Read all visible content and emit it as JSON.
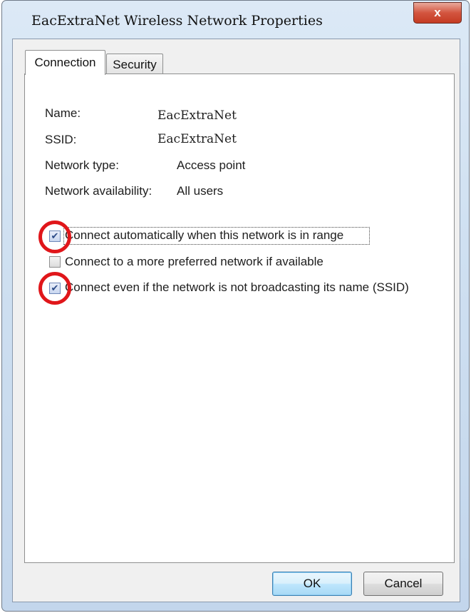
{
  "window": {
    "title": "EacExtraNet Wireless Network Properties",
    "close_glyph": "x"
  },
  "tabs": [
    {
      "label": "Connection"
    },
    {
      "label": "Security"
    }
  ],
  "info": {
    "name_label": "Name:",
    "name_value": "EacExtraNet",
    "ssid_label": "SSID:",
    "ssid_value": "EacExtraNet",
    "type_label": "Network type:",
    "type_value": "Access point",
    "avail_label": "Network availability:",
    "avail_value": "All users"
  },
  "options": [
    {
      "label": "Connect automatically when this network is in range",
      "checked": true
    },
    {
      "label": "Connect to a more preferred network if available",
      "checked": false
    },
    {
      "label": "Connect even if the network is not broadcasting its name (SSID)",
      "checked": true
    }
  ],
  "buttons": {
    "ok": "OK",
    "cancel": "Cancel"
  },
  "colors": {
    "highlight_circle": "#e0161a",
    "accent": "#3c7fb1"
  }
}
